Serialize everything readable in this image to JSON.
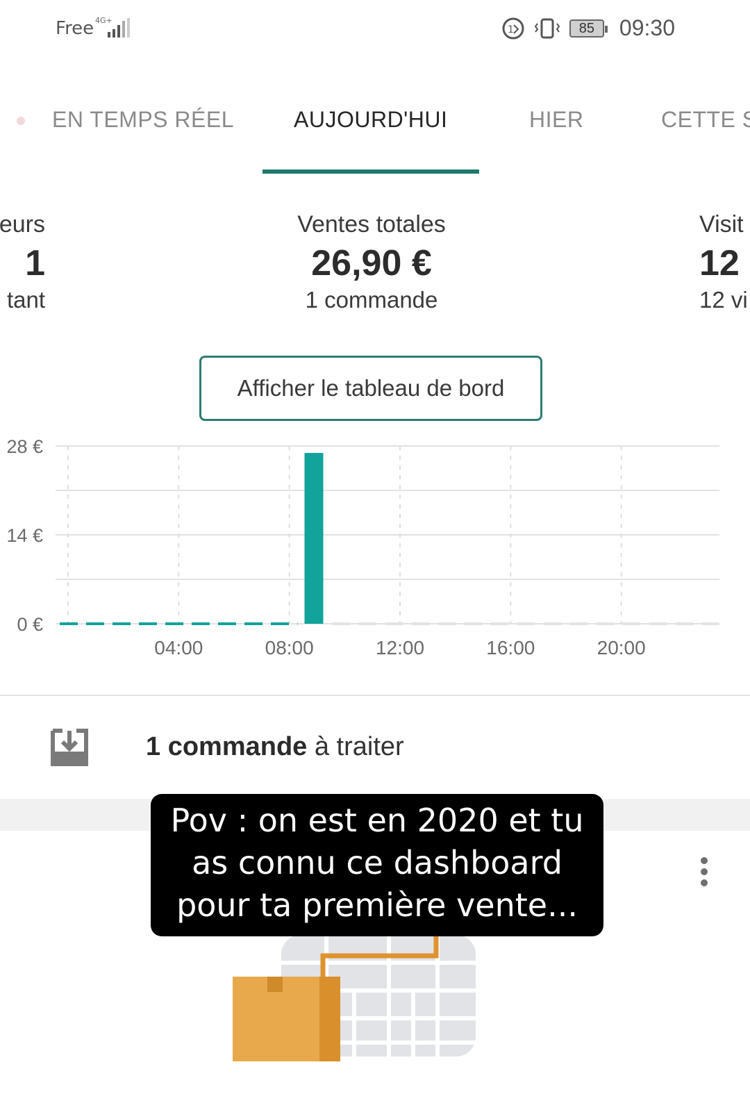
{
  "status_bar": {
    "carrier": "Free",
    "network": "4G+",
    "battery": "85",
    "time": "09:30"
  },
  "tabs": [
    {
      "label": "EN TEMPS RÉEL",
      "active": false
    },
    {
      "label": "AUJOURD'HUI",
      "active": true
    },
    {
      "label": "HIER",
      "active": false
    },
    {
      "label": "CETTE S",
      "active": false
    }
  ],
  "stats": {
    "left": {
      "label": "eurs",
      "value": "1",
      "sub": "tant"
    },
    "center": {
      "label": "Ventes totales",
      "value": "26,90 €",
      "sub": "1 commande"
    },
    "right": {
      "label": "Visit",
      "value": "12",
      "sub": "12 vi"
    }
  },
  "dashboard_button": "Afficher le tableau de bord",
  "chart_data": {
    "type": "bar",
    "x": [
      9
    ],
    "values": [
      26.9
    ],
    "bar_color": "#12a39a",
    "y_ticks": [
      "28 €",
      "14 €",
      "0 €"
    ],
    "x_ticks": [
      "04:00",
      "08:00",
      "12:00",
      "16:00",
      "20:00"
    ],
    "ylim": [
      0,
      28
    ],
    "xlim": [
      0,
      24
    ],
    "grid": true
  },
  "orders": {
    "count_bold": "1 commande",
    "rest": " à traiter"
  },
  "caption": {
    "line1": "Pov : on est en 2020 et tu",
    "line2": "as connu ce dashboard",
    "line3": "pour ta première vente..."
  },
  "colors": {
    "accent": "#1d7a6b",
    "bar": "#12a39a",
    "box": "#e8a94d"
  }
}
